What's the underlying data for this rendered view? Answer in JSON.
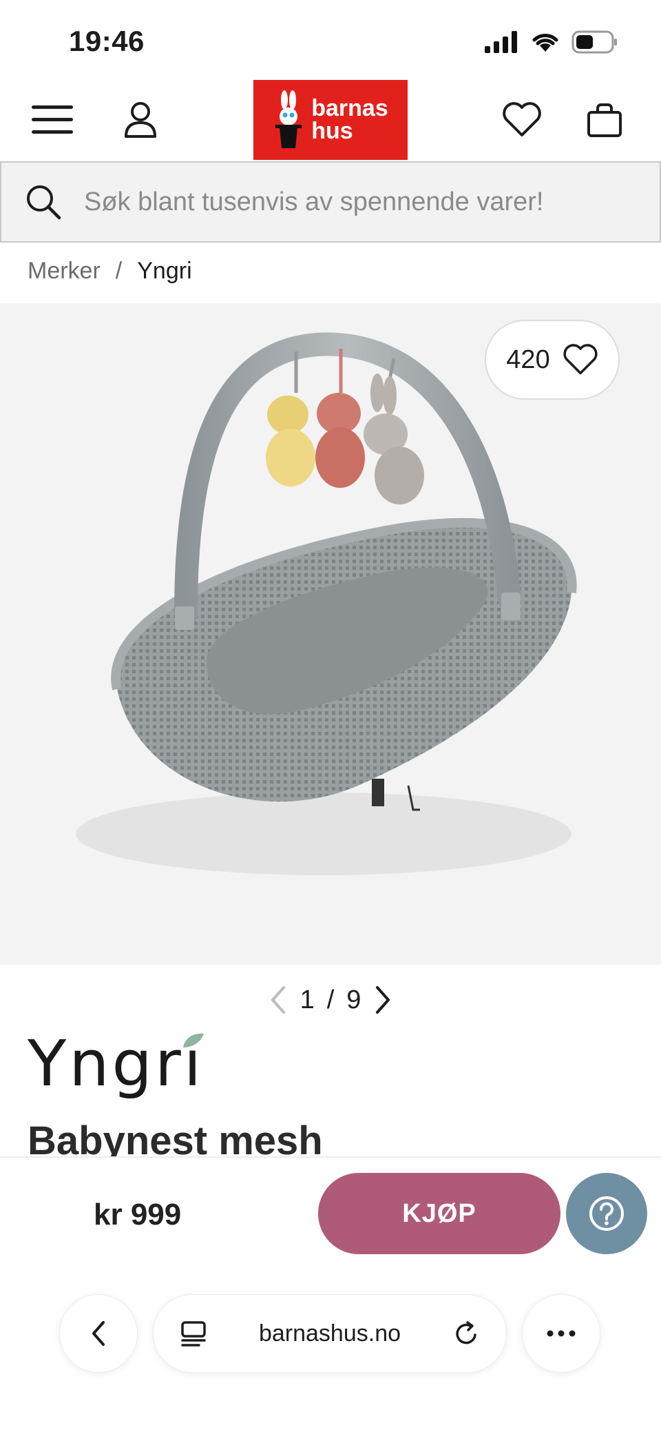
{
  "status_bar": {
    "time": "19:46"
  },
  "header": {
    "logo_line1": "barnas",
    "logo_line2": "hus",
    "brand_color": "#e3211c"
  },
  "search": {
    "placeholder": "Søk blant tusenvis av spennende varer!"
  },
  "breadcrumb": {
    "items": [
      "Merker",
      "Yngri"
    ],
    "separator": "/"
  },
  "gallery": {
    "favorite_count": "420",
    "pager": {
      "current": "1",
      "separator": "/",
      "total": "9"
    }
  },
  "product": {
    "brand": "Yngri",
    "title": "Babynest mesh"
  },
  "buy_bar": {
    "price": "kr 999",
    "buy_label": "KJØP",
    "accent": "#b05a7a",
    "help_color": "#6f8fa3"
  },
  "browser": {
    "url": "barnashus.no"
  }
}
